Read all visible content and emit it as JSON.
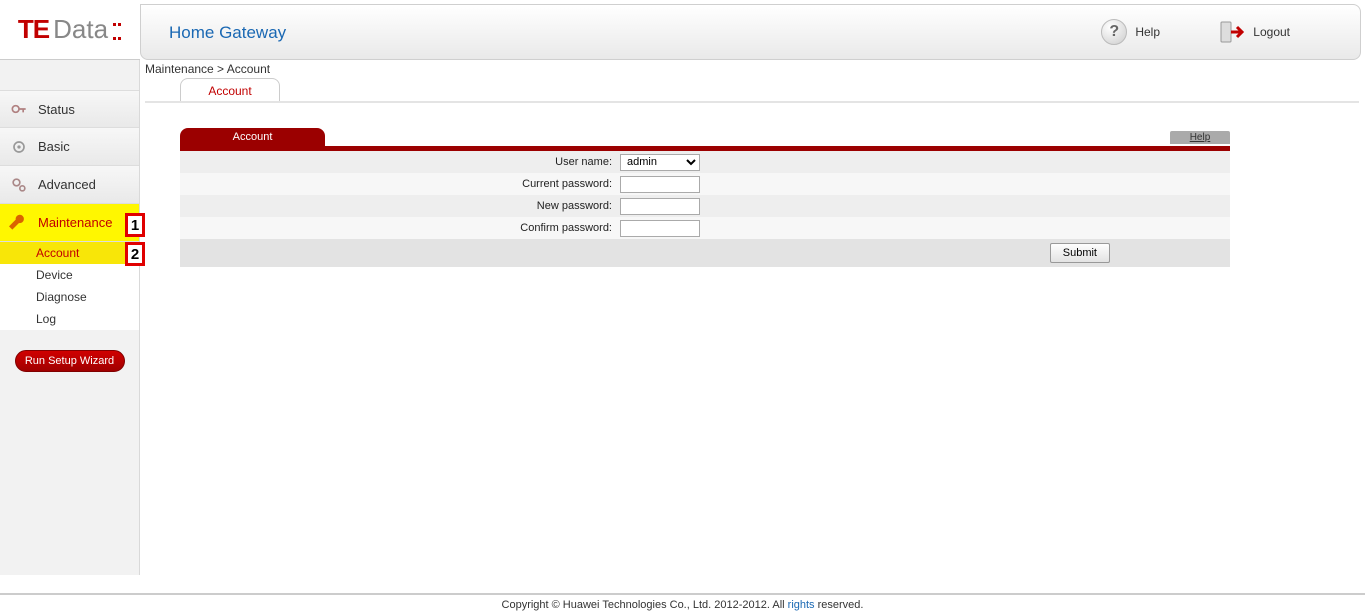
{
  "logo": {
    "te": "TE",
    "data": "Data"
  },
  "header": {
    "title": "Home Gateway",
    "help": "Help",
    "logout": "Logout"
  },
  "nav": {
    "status": "Status",
    "basic": "Basic",
    "advanced": "Advanced",
    "maintenance": "Maintenance",
    "sub": {
      "account": "Account",
      "device": "Device",
      "diagnose": "Diagnose",
      "log": "Log"
    },
    "wizard": "Run Setup Wizard"
  },
  "breadcrumb": "Maintenance > Account",
  "page_tab": "Account",
  "panel": {
    "title": "Account",
    "help": "Help",
    "labels": {
      "user": "User name:",
      "current": "Current password:",
      "new": "New password:",
      "confirm": "Confirm password:"
    },
    "user_value": "admin",
    "submit": "Submit"
  },
  "footer": {
    "pre": "Copyright © Huawei Technologies Co., Ltd. 2012-2012. All ",
    "rights": "rights",
    "post": " reserved."
  },
  "callouts": {
    "one": "1",
    "two": "2"
  }
}
